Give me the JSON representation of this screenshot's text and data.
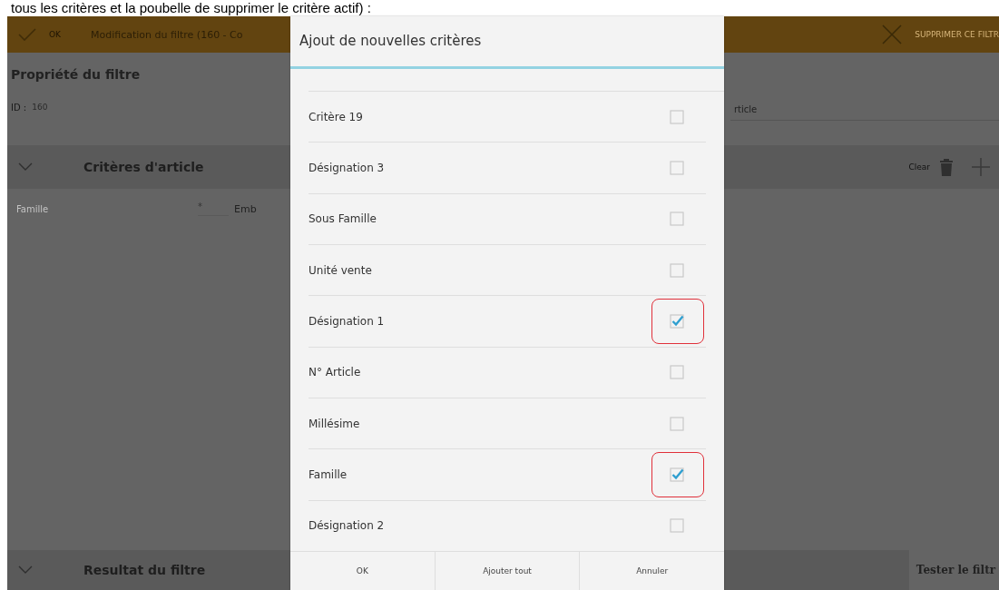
{
  "caption": "tous les critères et la poubelle de supprimer le critère actif) :",
  "action_bar": {
    "ok": "OK",
    "title": "Modification du filtre (160 - Co",
    "delete": "SUPPRIMER CE FILTR"
  },
  "properties": {
    "heading": "Propriété du filtre",
    "id_label": "ID :",
    "id_value": "160",
    "type_value": "rticle"
  },
  "criteria_section": {
    "title": "Critères d'article",
    "clear": "Clear",
    "expanded": true,
    "row": {
      "label": "Famille",
      "required": "*",
      "value": "Emb"
    }
  },
  "result_section": {
    "title": "Resultat du filtre",
    "test_button": "Tester le filtr"
  },
  "dialog": {
    "title": "Ajout de nouvelles critères",
    "items": [
      {
        "label": "Critère 19",
        "checked": false,
        "highlighted": false
      },
      {
        "label": "Désignation 3",
        "checked": false,
        "highlighted": false
      },
      {
        "label": "Sous Famille",
        "checked": false,
        "highlighted": false
      },
      {
        "label": "Unité vente",
        "checked": false,
        "highlighted": false
      },
      {
        "label": "Désignation 1",
        "checked": true,
        "highlighted": true
      },
      {
        "label": "N° Article",
        "checked": false,
        "highlighted": false
      },
      {
        "label": "Millésime",
        "checked": false,
        "highlighted": false
      },
      {
        "label": "Famille",
        "checked": true,
        "highlighted": true
      },
      {
        "label": "Désignation 2",
        "checked": false,
        "highlighted": false
      }
    ],
    "buttons": [
      "OK",
      "Ajouter tout",
      "Annuler"
    ]
  }
}
